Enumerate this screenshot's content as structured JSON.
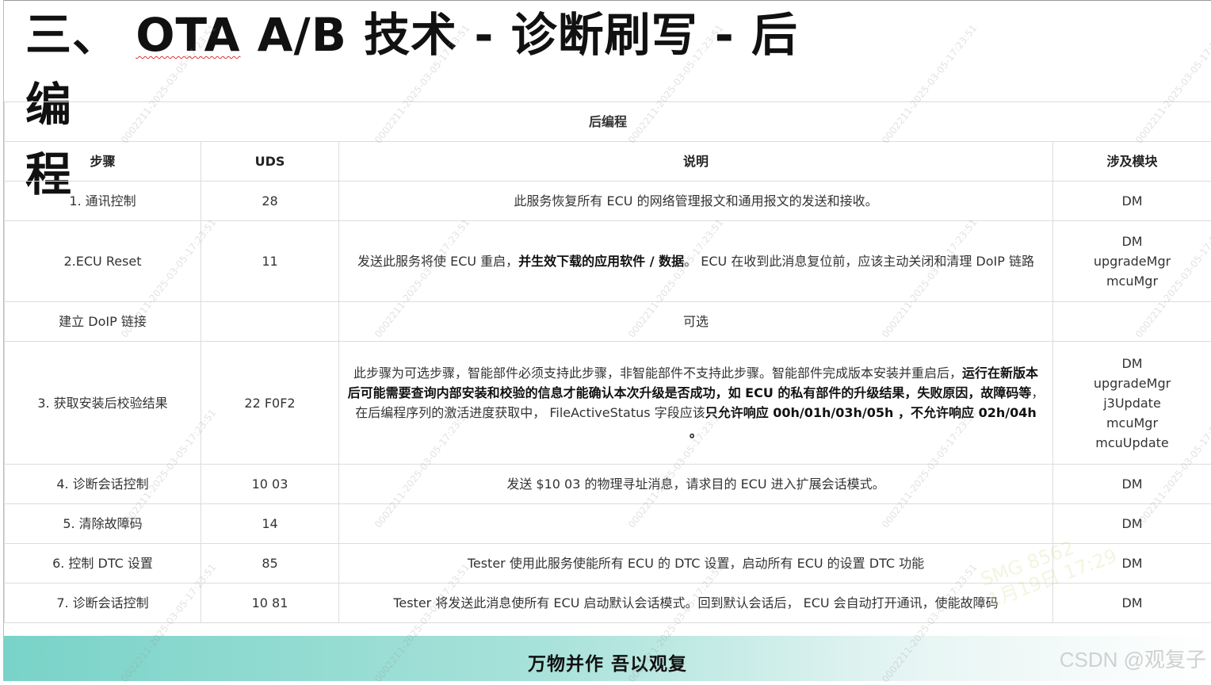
{
  "title": {
    "prefix": "三、 ",
    "underlined": "OTA",
    "rest": " A/B 技术 - 诊断刷写 - 后编",
    "line2": "程"
  },
  "table": {
    "caption": "后编程",
    "headers": [
      "步骤",
      "UDS",
      "说明",
      "涉及模块"
    ],
    "rows": [
      {
        "step": "1. 通讯控制",
        "uds": "28",
        "desc": [
          {
            "t": "此服务恢复所有 ECU 的网络管理报文和通用报文的发送和接收。",
            "b": false
          }
        ],
        "modules": [
          "DM"
        ]
      },
      {
        "step": "2.ECU Reset",
        "uds": "11",
        "desc": [
          {
            "t": "发送此服务将使 ECU 重启，",
            "b": false
          },
          {
            "t": "并生效下载的应用软件 / 数据",
            "b": true
          },
          {
            "t": "。 ECU 在收到此消息复位前，应该主动关闭和清理 DoIP 链路",
            "b": false
          }
        ],
        "modules": [
          "DM",
          "upgradeMgr",
          "mcuMgr"
        ]
      },
      {
        "step": "建立 DoIP 链接",
        "uds": "",
        "desc": [
          {
            "t": "可选",
            "b": false
          }
        ],
        "modules": []
      },
      {
        "step": "3. 获取安装后校验结果",
        "uds": "22 F0F2",
        "desc": [
          {
            "t": "此步骤为可选步骤，智能部件必须支持此步骤，非智能部件不支持此步骤。智能部件完成版本安装并重启后，",
            "b": false
          },
          {
            "t": "运行在新版本后可能需要查询内部安装和校验的信息才能确认本次升级是否成功，如 ECU 的私有部件的升级结果，失败原因，故障码等",
            "b": true
          },
          {
            "t": "，在后编程序列的激活进度获取中， FileActiveStatus 字段应该",
            "b": false
          },
          {
            "t": "只允许响应 00h/01h/03h/05h ，不允许响应 02h/04h 。",
            "b": true
          }
        ],
        "modules": [
          "DM",
          "upgradeMgr",
          "j3Update",
          "mcuMgr",
          "mcuUpdate"
        ]
      },
      {
        "step": "4. 诊断会话控制",
        "uds": "10 03",
        "desc": [
          {
            "t": "发送 $10 03 的物理寻址消息，请求目的 ECU 进入扩展会话模式。",
            "b": false
          }
        ],
        "modules": [
          "DM"
        ]
      },
      {
        "step": "5. 清除故障码",
        "uds": "14",
        "desc": [],
        "modules": [
          "DM"
        ]
      },
      {
        "step": "6. 控制 DTC 设置",
        "uds": "85",
        "desc": [
          {
            "t": "Tester 使用此服务使能所有 ECU 的 DTC 设置，启动所有 ECU 的设置 DTC 功能",
            "b": false
          }
        ],
        "modules": [
          "DM"
        ]
      },
      {
        "step": "7. 诊断会话控制",
        "uds": "10 81",
        "desc": [
          {
            "t": "Tester 将发送此消息使所有 ECU 启动默认会话模式。回到默认会话后， ECU 会自动打开通讯，使能故障码",
            "b": false
          }
        ],
        "modules": [
          "DM"
        ]
      }
    ]
  },
  "footer": {
    "slogan": "万物并作 吾以观复"
  },
  "csdn_mark": "CSDN @观复子",
  "watermark_text": "0002211-2025-03-05-17:23:51",
  "stamp_text": [
    "SMG 8562",
    "1月19日 17:29"
  ]
}
